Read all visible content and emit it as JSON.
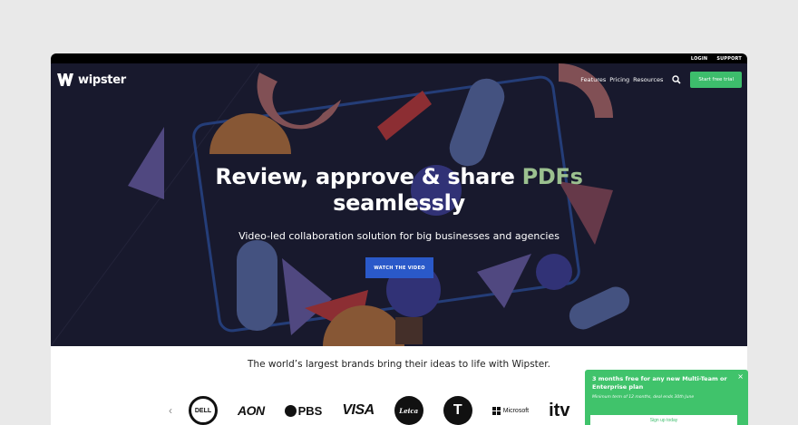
{
  "topbar": {
    "login": "LOGIN",
    "support": "SUPPORT"
  },
  "brand": {
    "name": "wipster"
  },
  "nav": {
    "links": [
      "Features",
      "Pricing",
      "Resources"
    ],
    "search_icon": "search-icon",
    "cta": "Start free trial"
  },
  "hero": {
    "headline_part1": "Review, approve & share ",
    "headline_accent": "PDFs",
    "headline_part2": "seamlessly",
    "subheadline": "Video-led collaboration solution for big businesses and agencies",
    "cta": "WATCH THE VIDEO"
  },
  "brands": {
    "title": "The world’s largest brands bring their ideas to life with Wipster.",
    "prev_icon": "chevron-left-icon",
    "logos": [
      "DELL",
      "AON",
      "PBS",
      "VISA",
      "Leica",
      "T",
      "Microsoft",
      "itv"
    ]
  },
  "promo": {
    "title": "3 months free for any new Multi-Team or Enterprise plan",
    "note": "Minimum term of 12 months, deal ends 30th June",
    "cta": "Sign up today",
    "close": "×"
  },
  "colors": {
    "accent_green": "#3dbd6c",
    "hero_bg": "#1b1c31",
    "watch_button": "#2a59c9",
    "pdf_accent": "#9bc08f"
  }
}
